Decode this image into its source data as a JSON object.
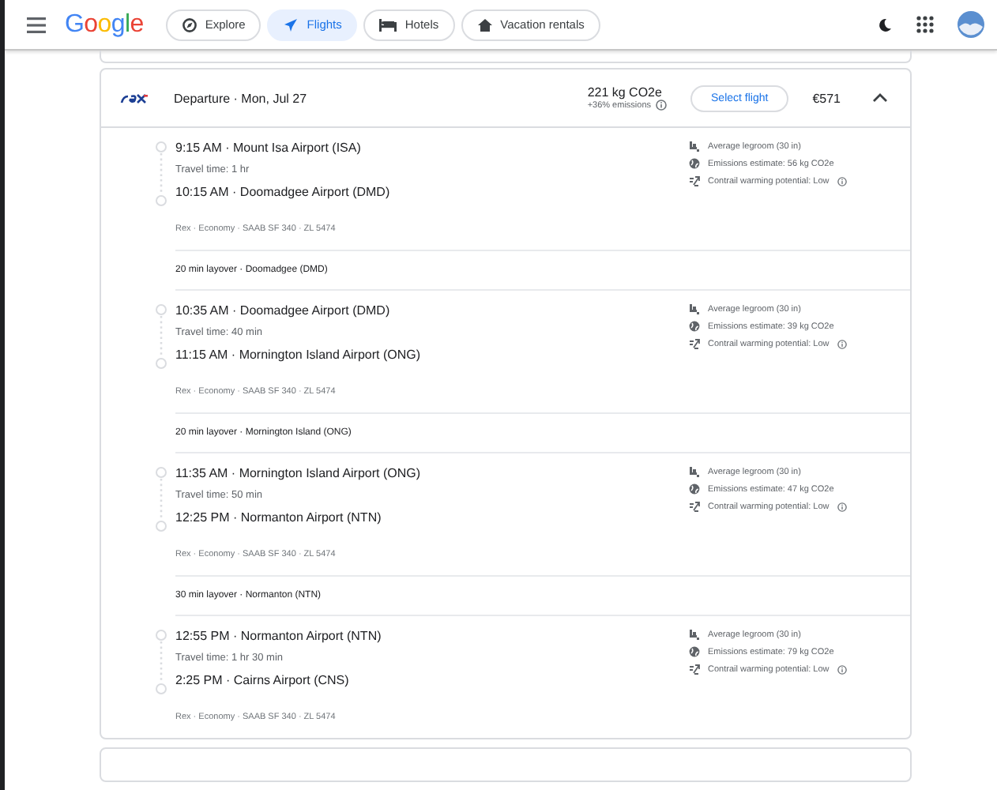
{
  "header": {
    "logo": "Google",
    "tabs": [
      {
        "label": "Explore",
        "selected": false
      },
      {
        "label": "Flights",
        "selected": true
      },
      {
        "label": "Hotels",
        "selected": false
      },
      {
        "label": "Vacation rentals",
        "selected": false
      }
    ]
  },
  "flight": {
    "title": "Departure · Mon, Jul 27",
    "emissions": "221 kg CO2e",
    "emissions_delta": "+36% emissions",
    "select_label": "Select flight",
    "price": "€571",
    "expanded": true,
    "legs": [
      {
        "kind": "segment",
        "departure": "9:15 AM · Mount Isa Airport (ISA)",
        "travel_time": "Travel time: 1 hr",
        "arrival": "10:15 AM · Doomadgee Airport (DMD)",
        "details": "Rex · Economy · SAAB SF 340 · ZL 5474",
        "legroom": "Average legroom (30 in)",
        "emissions": "Emissions estimate: 56 kg CO2e",
        "contrail": "Contrail warming potential: Low"
      },
      {
        "kind": "layover",
        "text": "20 min layover · Doomadgee (DMD)"
      },
      {
        "kind": "segment",
        "departure": "10:35 AM · Doomadgee Airport (DMD)",
        "travel_time": "Travel time: 40 min",
        "arrival": "11:15 AM · Mornington Island Airport (ONG)",
        "details": "Rex · Economy · SAAB SF 340 · ZL 5474",
        "legroom": "Average legroom (30 in)",
        "emissions": "Emissions estimate: 39 kg CO2e",
        "contrail": "Contrail warming potential: Low"
      },
      {
        "kind": "layover",
        "text": "20 min layover · Mornington Island (ONG)"
      },
      {
        "kind": "segment",
        "departure": "11:35 AM · Mornington Island Airport (ONG)",
        "travel_time": "Travel time: 50 min",
        "arrival": "12:25 PM · Normanton Airport (NTN)",
        "details": "Rex · Economy · SAAB SF 340 · ZL 5474",
        "legroom": "Average legroom (30 in)",
        "emissions": "Emissions estimate: 47 kg CO2e",
        "contrail": "Contrail warming potential: Low"
      },
      {
        "kind": "layover",
        "text": "30 min layover · Normanton (NTN)"
      },
      {
        "kind": "segment",
        "departure": "12:55 PM · Normanton Airport (NTN)",
        "travel_time": "Travel time: 1 hr 30 min",
        "arrival": "2:25 PM · Cairns Airport (CNS)",
        "details": "Rex · Economy · SAAB SF 340 · ZL 5474",
        "legroom": "Average legroom (30 in)",
        "emissions": "Emissions estimate: 79 kg CO2e",
        "contrail": "Contrail warming potential: Low"
      }
    ]
  }
}
